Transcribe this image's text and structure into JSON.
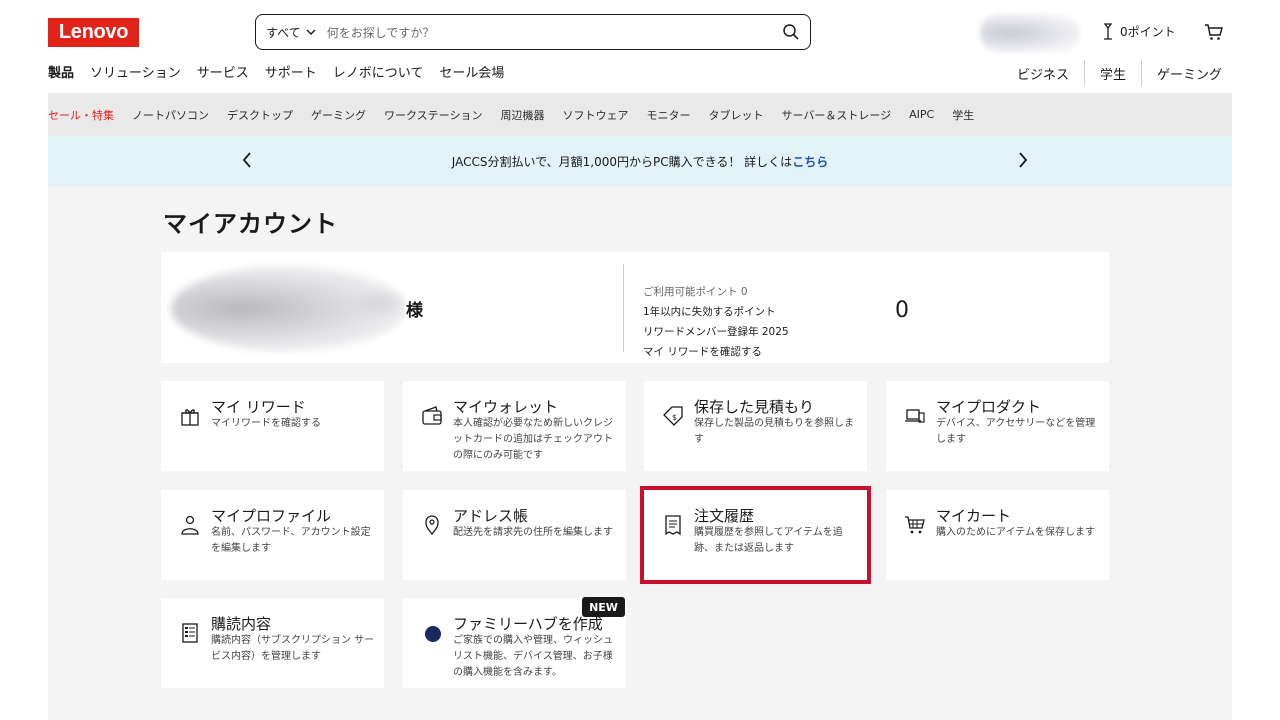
{
  "header": {
    "logo": "Lenovo",
    "search_category": "すべて",
    "search_placeholder": "何をお探しですか？",
    "points_label": "0ポイント"
  },
  "nav_main": [
    "製品",
    "ソリューション",
    "サービス",
    "サポート",
    "レノボについて",
    "セール会場"
  ],
  "nav_right": [
    "ビジネス",
    "学生",
    "ゲーミング"
  ],
  "category_bar": [
    "セール・特集",
    "ノートパソコン",
    "デスクトップ",
    "ゲーミング",
    "ワークステーション",
    "周辺機器",
    "ソフトウェア",
    "モニター",
    "タブレット",
    "サーバー＆ストレージ",
    "AIPC",
    "学生"
  ],
  "promo": {
    "text": "JACCS分割払いで、月額1,000円からPC購入できる！ 詳しくは",
    "link": "こちら"
  },
  "page_title": "マイアカウント",
  "account": {
    "honorific": "様",
    "available_points_label": "ご利用可能ポイント 0",
    "expiring_label": "1年以内に失効するポイント",
    "member_year_label": "リワードメンバー登録年 2025",
    "rewards_link": "マイ リワードを確認する",
    "points_value": "0"
  },
  "tiles": [
    {
      "title": "マイ リワード",
      "desc": "マイリワードを確認する",
      "icon": "gift-icon"
    },
    {
      "title": "マイウォレット",
      "desc": "本人確認が必要なため新しいクレジットカードの追加はチェックアウトの際にのみ可能です",
      "icon": "wallet-icon"
    },
    {
      "title": "保存した見積もり",
      "desc": "保存した製品の見積もりを参照します",
      "icon": "price-tag-icon"
    },
    {
      "title": "マイプロダクト",
      "desc": "デバイス、アクセサリーなどを管理します",
      "icon": "devices-icon"
    },
    {
      "title": "マイプロファイル",
      "desc": "名前、パスワード、アカウント設定を編集します",
      "icon": "user-icon"
    },
    {
      "title": "アドレス帳",
      "desc": "配送先を請求先の住所を編集します",
      "icon": "location-pin-icon"
    },
    {
      "title": "注文履歴",
      "desc": "購買履歴を参照してアイテムを追跡、または返品します",
      "icon": "receipt-icon"
    },
    {
      "title": "マイカート",
      "desc": "購入のためにアイテムを保存します",
      "icon": "cart-icon"
    },
    {
      "title": "購読内容",
      "desc": "購読内容（サブスクリプション サービス内容）を管理します",
      "icon": "subscription-list-icon"
    },
    {
      "title": "ファミリーハブを作成",
      "desc": "ご家族での購入や管理、ウィッシュリスト機能、デバイス管理、お子様の購入機能を含みます。",
      "icon": "family-hub-icon"
    }
  ],
  "new_badge": "NEW",
  "colors": {
    "brand_red": "#e2231a",
    "highlight_red": "#c8102e",
    "promo_bg": "#e3f2f8",
    "link_blue": "#1f55a8"
  }
}
